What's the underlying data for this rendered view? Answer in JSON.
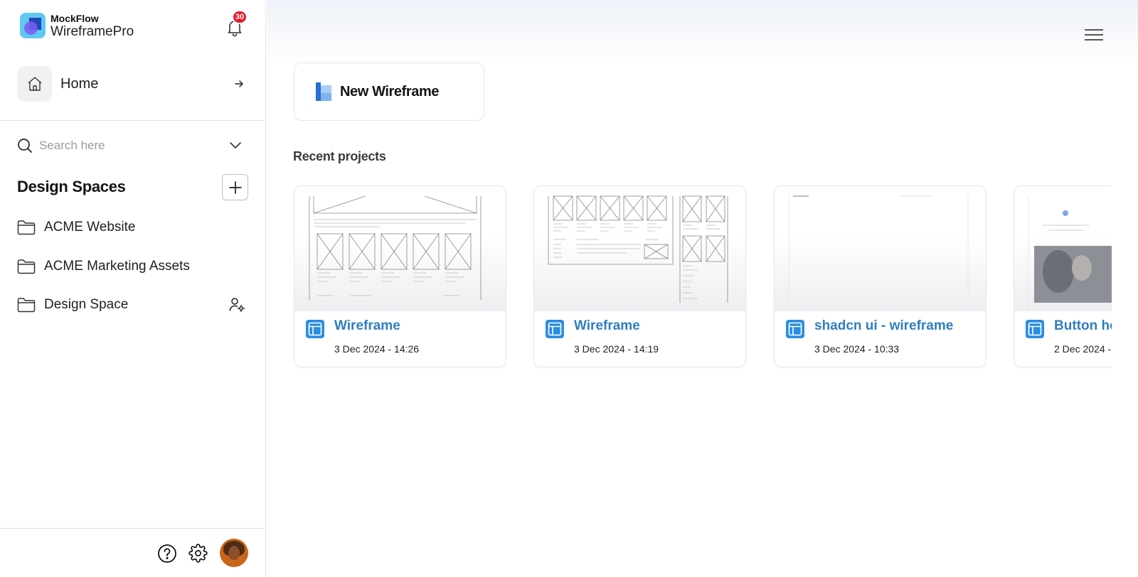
{
  "brand": {
    "top": "MockFlow",
    "bottom": "WireframePro"
  },
  "notifications": {
    "count": "30"
  },
  "nav": {
    "home_label": "Home"
  },
  "search": {
    "placeholder": "Search here"
  },
  "design_spaces": {
    "title": "Design Spaces",
    "items": [
      {
        "label": "ACME Website"
      },
      {
        "label": "ACME Marketing Assets"
      },
      {
        "label": "Design Space"
      }
    ]
  },
  "new_wireframe": {
    "label": "New Wireframe"
  },
  "recent": {
    "title": "Recent projects",
    "projects": [
      {
        "title": "Wireframe",
        "date": "3 Dec 2024 - 14:26"
      },
      {
        "title": "Wireframe",
        "date": "3 Dec 2024 - 14:19"
      },
      {
        "title": "shadcn ui - wireframe",
        "date": "3 Dec 2024 - 10:33"
      },
      {
        "title": "Button ho",
        "date": "2 Dec 2024 - 1"
      }
    ]
  },
  "icons": {
    "bell": "bell-icon",
    "home": "home-icon",
    "arrow": "arrow-right-icon",
    "search": "search-icon",
    "chevron": "chevron-down-icon",
    "plus": "plus-icon",
    "folder": "folder-icon",
    "user_settings": "user-settings-icon",
    "help": "help-icon",
    "gear": "gear-icon",
    "menu": "hamburger-menu-icon",
    "wireframe": "wireframe-doc-icon"
  },
  "colors": {
    "accent": "#2f7ec1",
    "badge": "#e11d2a",
    "logo": "#5ec8f2"
  }
}
